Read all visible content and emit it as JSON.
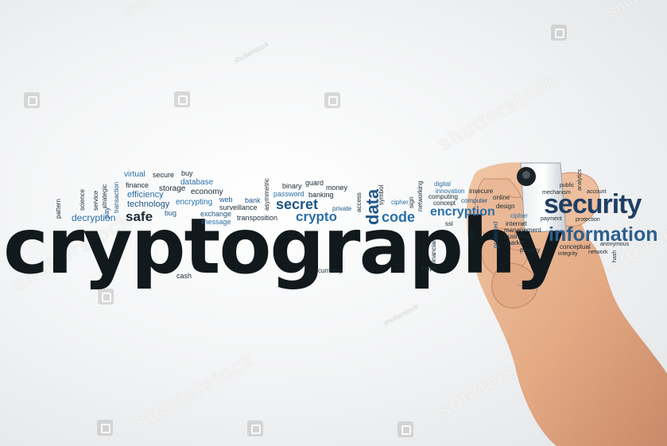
{
  "image": {
    "headline": "cryptography",
    "colors": {
      "dark": "#0f1a1f",
      "blue": "#2a6fa8",
      "navy": "#1f3e63",
      "teal": "#3a8fb8",
      "gray": "#555f66"
    },
    "words": {
      "security": "security",
      "information": "information",
      "crypto": "crypto",
      "secret": "secret",
      "code": "code",
      "data": "data",
      "encryption": "encryption",
      "safe": "safe",
      "decryption": "decryption",
      "technology": "technology",
      "efficiency": "efficiency",
      "finance": "finance",
      "storage": "storage",
      "virtual": "virtual",
      "secure": "secure",
      "buy": "buy",
      "database": "database",
      "economy": "economy",
      "encrypting": "encrypting",
      "web": "web",
      "bank": "bank",
      "exchange": "exchange",
      "message": "message",
      "surveillance": "surveillance",
      "transposition": "transposition",
      "bug": "bug",
      "binary": "binary",
      "guard": "guard",
      "money": "money",
      "password": "password",
      "banking": "banking",
      "private": "private",
      "access": "access",
      "symbol": "symbol",
      "cipher": "cipher",
      "sign": "sign",
      "digital": "digital",
      "innovation": "innovation",
      "insecure": "insecure",
      "computing": "computing",
      "online": "online",
      "concept": "concept",
      "design": "design",
      "computer": "computer",
      "networking": "networking",
      "ssl": "ssl",
      "key": "key",
      "protected": "protected",
      "financial": "financial",
      "loupe": "loupe",
      "currency": "currency",
      "cash": "cash",
      "pay": "pay",
      "pattern": "pattern",
      "science": "science",
      "service": "service",
      "strategic": "strategic",
      "transaction": "transaction",
      "asymmetric": "asymmetric",
      "public": "public",
      "analytics": "analytics",
      "account": "account",
      "mechanism": "mechanism",
      "payment": "payment",
      "protection": "protection",
      "internet": "internet",
      "management": "management",
      "business": "business",
      "market": "market",
      "privacy": "privacy",
      "conceptual": "conceptual",
      "anonymous": "anonymous",
      "integrity": "integrity",
      "network": "network",
      "hash": "hash",
      "cipher2": "cipher"
    },
    "watermark": {
      "text": "shutterstock",
      "faint": "shutterstock"
    }
  }
}
